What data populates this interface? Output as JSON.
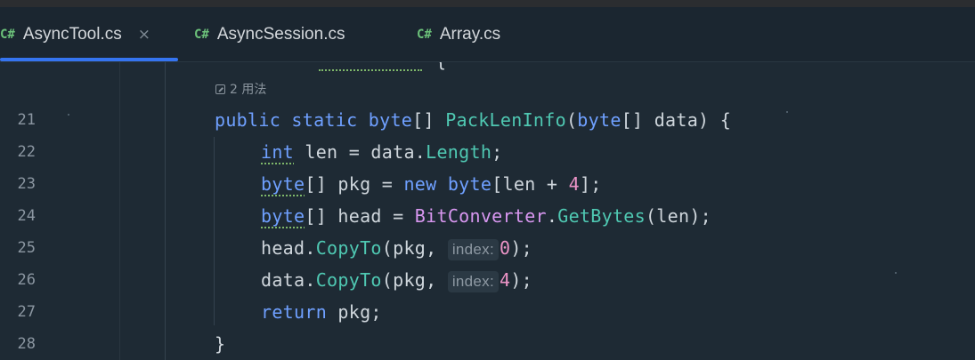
{
  "tabs": [
    {
      "lang": "C#",
      "name": "AsyncTool.cs",
      "close": "×"
    },
    {
      "lang": "C#",
      "name": "AsyncSession.cs"
    },
    {
      "lang": "C#",
      "name": "Array.cs"
    }
  ],
  "editor": {
    "usage_hint": "2 用法",
    "lines": [
      {
        "num": "21"
      },
      {
        "num": "22"
      },
      {
        "num": "23"
      },
      {
        "num": "24"
      },
      {
        "num": "25"
      },
      {
        "num": "26"
      },
      {
        "num": "27"
      },
      {
        "num": "28"
      }
    ],
    "code": {
      "l21": [
        "public",
        " ",
        "static",
        " ",
        "byte",
        "[] ",
        "PackLenInfo",
        "(",
        "byte",
        "[] data) {"
      ],
      "l22": [
        "int",
        " len = data.",
        "Length",
        ";"
      ],
      "l23": [
        "byte",
        "[] pkg = ",
        "new",
        " ",
        "byte",
        "[len + ",
        "4",
        "];"
      ],
      "l24": [
        "byte",
        "[] head = ",
        "BitConverter",
        ".",
        "GetBytes",
        "(len);"
      ],
      "l25": [
        "head.",
        "CopyTo",
        "(pkg, ",
        "index:",
        "0",
        ");"
      ],
      "l26": [
        "data.",
        "CopyTo",
        "(pkg, ",
        "index:",
        "4",
        ");"
      ],
      "l27": [
        "return",
        " pkg;"
      ],
      "l28": [
        "}"
      ]
    }
  },
  "colors": {
    "background": "#1e2a34",
    "keyword": "#6fa0ff",
    "method": "#4fc8b2",
    "class": "#d897f0",
    "number": "#ec94c7",
    "tab_underline": "#3574f0"
  }
}
